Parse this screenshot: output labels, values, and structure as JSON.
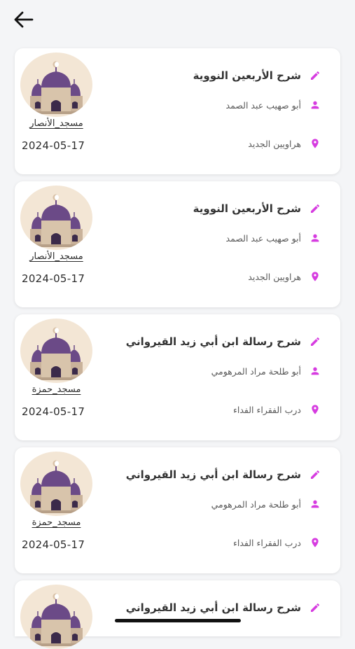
{
  "colors": {
    "accent": "#d63ce0",
    "background": "#f4f5f7",
    "card": "#ffffff",
    "avatar_bg": "#f3e6d5",
    "dome": "#6b4a87"
  },
  "header": {
    "back_icon": "arrow-left-icon"
  },
  "lessons": [
    {
      "title": "شرح الأربعين النووية",
      "sheikh": "أبو صهيب عبد الصمد",
      "location": "هراويين الجديد",
      "mosque": "مسجد_الأنصار",
      "date": "2024-05-17"
    },
    {
      "title": "شرح الأربعين النووية",
      "sheikh": "أبو صهيب عبد الصمد",
      "location": "هراويين الجديد",
      "mosque": "مسجد_الأنصار",
      "date": "2024-05-17"
    },
    {
      "title": "شرح رسالة ابن أبي زيد القيرواني",
      "sheikh": "أبو طلحة مراد المرهومي",
      "location": "درب الفقراء الفداء",
      "mosque": "مسجد_حمزة",
      "date": "2024-05-17"
    },
    {
      "title": "شرح رسالة ابن أبي زيد القيرواني",
      "sheikh": "أبو طلحة مراد المرهومي",
      "location": "درب الفقراء الفداء",
      "mosque": "مسجد_حمزة",
      "date": "2024-05-17"
    },
    {
      "title": "شرح رسالة ابن أبي زيد القيرواني"
    }
  ]
}
